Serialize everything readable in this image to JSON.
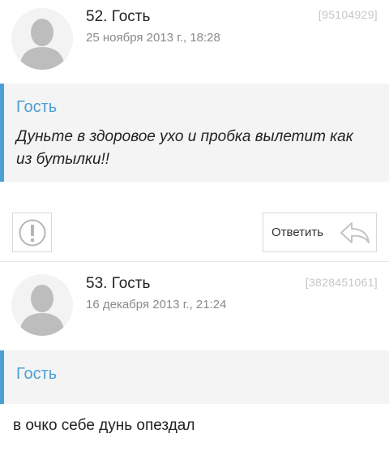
{
  "comments": [
    {
      "number_author": "52. Гость",
      "date": "25 ноября 2013 г., 18:28",
      "id": "[95104929]",
      "quote_author": "Гость",
      "quote_text": "Дуньте в здоровое ухо и пробка вылетит как из бутылки!!"
    },
    {
      "number_author": "53. Гость",
      "date": "16 декабря 2013 г., 21:24",
      "id": "[3828451061]",
      "quote_author": "Гость",
      "body_text": "в очко себе дунь опездал"
    }
  ],
  "actions": {
    "report_icon": "exclamation-circle-icon",
    "reply_label": "Ответить",
    "reply_icon": "reply-arrow-icon"
  },
  "colors": {
    "accent": "#4a9fd5",
    "quote_bg": "#f4f4f4",
    "muted_text": "#8a8a8a",
    "id_text": "#c6c6c6"
  }
}
